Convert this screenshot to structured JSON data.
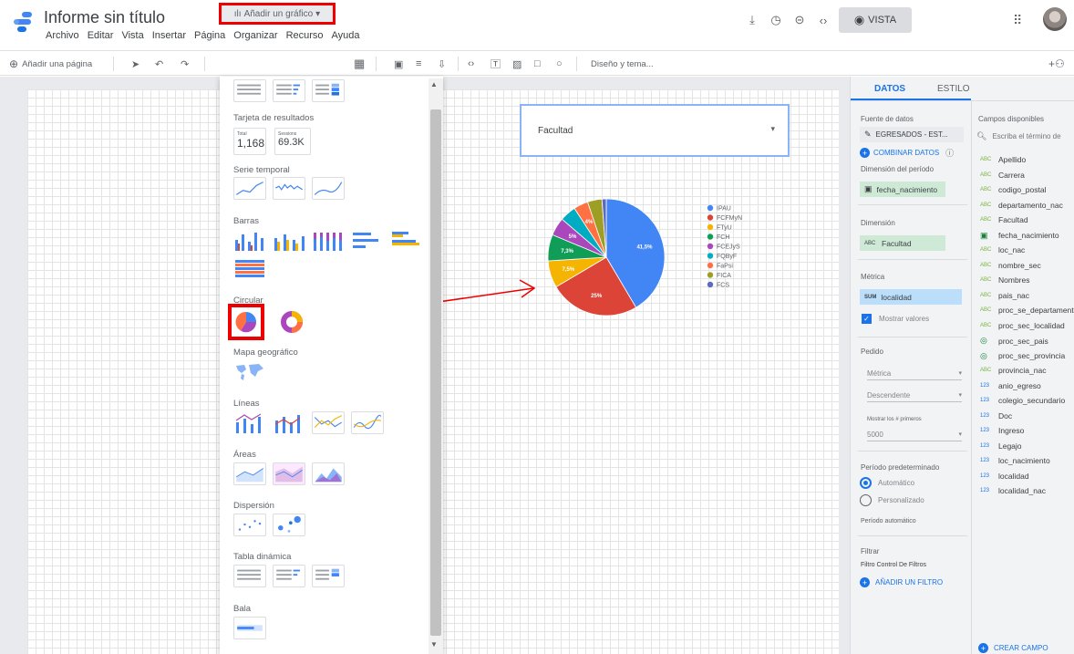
{
  "app": {
    "title": "Informe sin título",
    "menu": [
      "Archivo",
      "Editar",
      "Vista",
      "Insertar",
      "Página",
      "Organizar",
      "Recurso",
      "Ayuda"
    ],
    "view_button": "VISTA"
  },
  "toolbar": {
    "add_page": "Añadir una página",
    "add_chart": "Añadir un gráfico",
    "theme": "Diseño y tema..."
  },
  "chart_menu": {
    "sections": {
      "scorecard": "Tarjeta de resultados",
      "timeseries": "Serie temporal",
      "bars": "Barras",
      "pie": "Circular",
      "geo": "Mapa geográfico",
      "lines": "Líneas",
      "areas": "Áreas",
      "scatter": "Dispersión",
      "pivot": "Tabla dinámica",
      "bullet": "Bala"
    },
    "scorecard_a_label": "Total",
    "scorecard_a_value": "1,168",
    "scorecard_b_label": "Sessions",
    "scorecard_b_value": "69.3K"
  },
  "canvas": {
    "filter_control_label": "Facultad"
  },
  "chart_data": {
    "type": "pie",
    "categories": [
      "IPAU",
      "FCFMyN",
      "FTyU",
      "FCH",
      "FCEJyS",
      "FQByF",
      "FaPsi",
      "FICA",
      "FCS"
    ],
    "values": [
      41.5,
      25,
      7.5,
      7.3,
      5,
      4.5,
      4,
      4,
      1.2
    ],
    "labels": [
      "41,5%",
      "25%",
      "7,5%",
      "7,3%",
      "5%",
      "",
      "4%",
      "",
      ""
    ],
    "colors": [
      "#4285f4",
      "#db4437",
      "#f4b400",
      "#0f9d58",
      "#ab47bc",
      "#00acc1",
      "#ff7043",
      "#9e9d24",
      "#5c6bc0"
    ],
    "legend_position": "right"
  },
  "right_panel": {
    "tab_data": "DATOS",
    "tab_style": "ESTILO",
    "source_label": "Fuente de datos",
    "source_value": "EGRESADOS - EST...",
    "combine": "COMBINAR DATOS",
    "period_dim_label": "Dimensión del período",
    "period_dim_value": "fecha_nacimiento",
    "dimension_label": "Dimensión",
    "dimension_value": "Facultad",
    "metric_label": "Métrica",
    "metric_value": "localidad",
    "metric_agg": "SUM",
    "show_values": "Mostrar valores",
    "order_label": "Pedido",
    "order_metric": "Métrica",
    "order_dir": "Descendente",
    "show_first_label": "Mostrar los # primeros",
    "show_first_value": "5000",
    "default_period_label": "Período predeterminado",
    "auto": "Automático",
    "custom": "Personalizado",
    "auto_period": "Período automático",
    "filter_label": "Filtrar",
    "filter_control": "Filtro Control De Filtros",
    "add_filter": "AÑADIR UN FILTRO",
    "fields_label": "Campos disponibles",
    "search_placeholder": "Escriba el término de",
    "create_field": "CREAR CAMPO",
    "fields": [
      {
        "type": "ABC",
        "name": "Apellido"
      },
      {
        "type": "ABC",
        "name": "Carrera"
      },
      {
        "type": "ABC",
        "name": "codigo_postal"
      },
      {
        "type": "ABC",
        "name": "departamento_nac"
      },
      {
        "type": "ABC",
        "name": "Facultad"
      },
      {
        "type": "DATE",
        "name": "fecha_nacimiento"
      },
      {
        "type": "ABC",
        "name": "loc_nac"
      },
      {
        "type": "ABC",
        "name": "nombre_sec"
      },
      {
        "type": "ABC",
        "name": "Nombres"
      },
      {
        "type": "ABC",
        "name": "pais_nac"
      },
      {
        "type": "ABC",
        "name": "proc_se_departamento"
      },
      {
        "type": "ABC",
        "name": "proc_sec_localidad"
      },
      {
        "type": "GEO",
        "name": "proc_sec_pais"
      },
      {
        "type": "GEO",
        "name": "proc_sec_provincia"
      },
      {
        "type": "ABC",
        "name": "provincia_nac"
      },
      {
        "type": "123",
        "name": "anio_egreso"
      },
      {
        "type": "123",
        "name": "colegio_secundario"
      },
      {
        "type": "123",
        "name": "Doc"
      },
      {
        "type": "123",
        "name": "Ingreso"
      },
      {
        "type": "123",
        "name": "Legajo"
      },
      {
        "type": "123",
        "name": "loc_nacimiento"
      },
      {
        "type": "123",
        "name": "localidad"
      },
      {
        "type": "123",
        "name": "localidad_nac"
      }
    ]
  }
}
